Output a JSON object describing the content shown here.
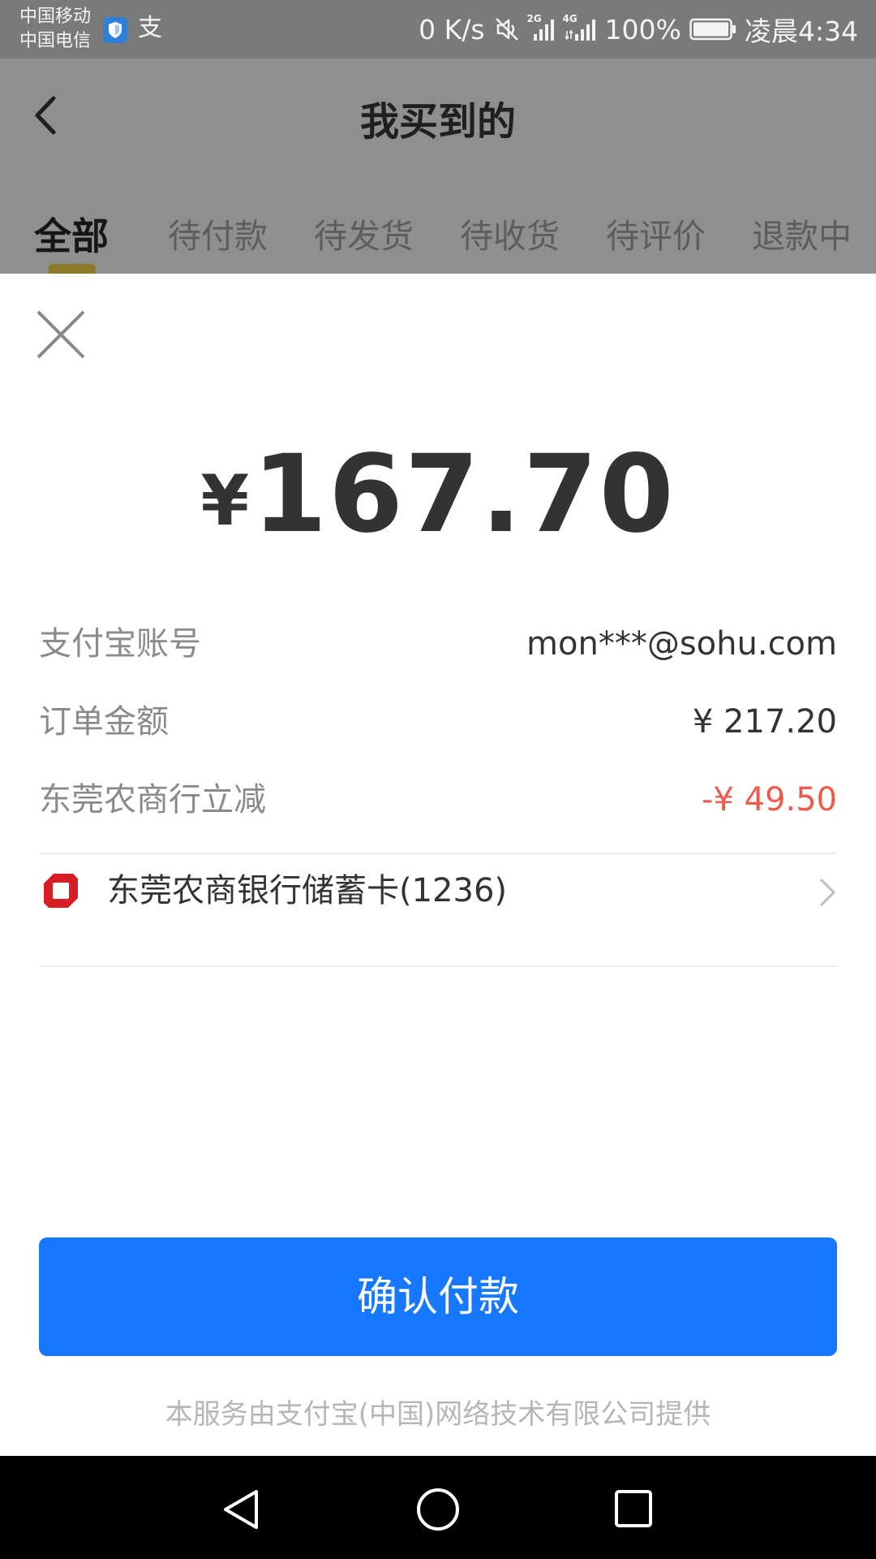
{
  "status_bar": {
    "carrier_1": "中国移动",
    "carrier_2": "中国电信",
    "alipay_glyph": "支",
    "net_speed": "0 K/s",
    "signal_1_label": "2G",
    "signal_2_label": "4G",
    "battery": "100%",
    "time": "凌晨4:34"
  },
  "app_header": {
    "title": "我买到的",
    "tabs": [
      {
        "label": "全部",
        "active": true
      },
      {
        "label": "待付款"
      },
      {
        "label": "待发货"
      },
      {
        "label": "待收货"
      },
      {
        "label": "待评价"
      },
      {
        "label": "退款中"
      }
    ]
  },
  "payment": {
    "currency_symbol": "¥",
    "amount": "167.70",
    "rows": [
      {
        "label": "支付宝账号",
        "value": "mon***@sohu.com"
      },
      {
        "label": "订单金额",
        "value": "¥ 217.20"
      },
      {
        "label": "东莞农商行立减",
        "value": "-¥ 49.50"
      }
    ],
    "payment_method": "东莞农商银行储蓄卡(1236)",
    "confirm_label": "确认付款",
    "footer": "本服务由支付宝(中国)网络技术有限公司提供"
  },
  "colors": {
    "primary_button": "#1677ff",
    "discount_text": "#f05a4a",
    "bank_logo": "#d81e25"
  },
  "icons": {
    "close": "close-icon",
    "back": "back-icon",
    "chevron": "chevron-right-icon",
    "bank": "bank-logo-icon"
  }
}
